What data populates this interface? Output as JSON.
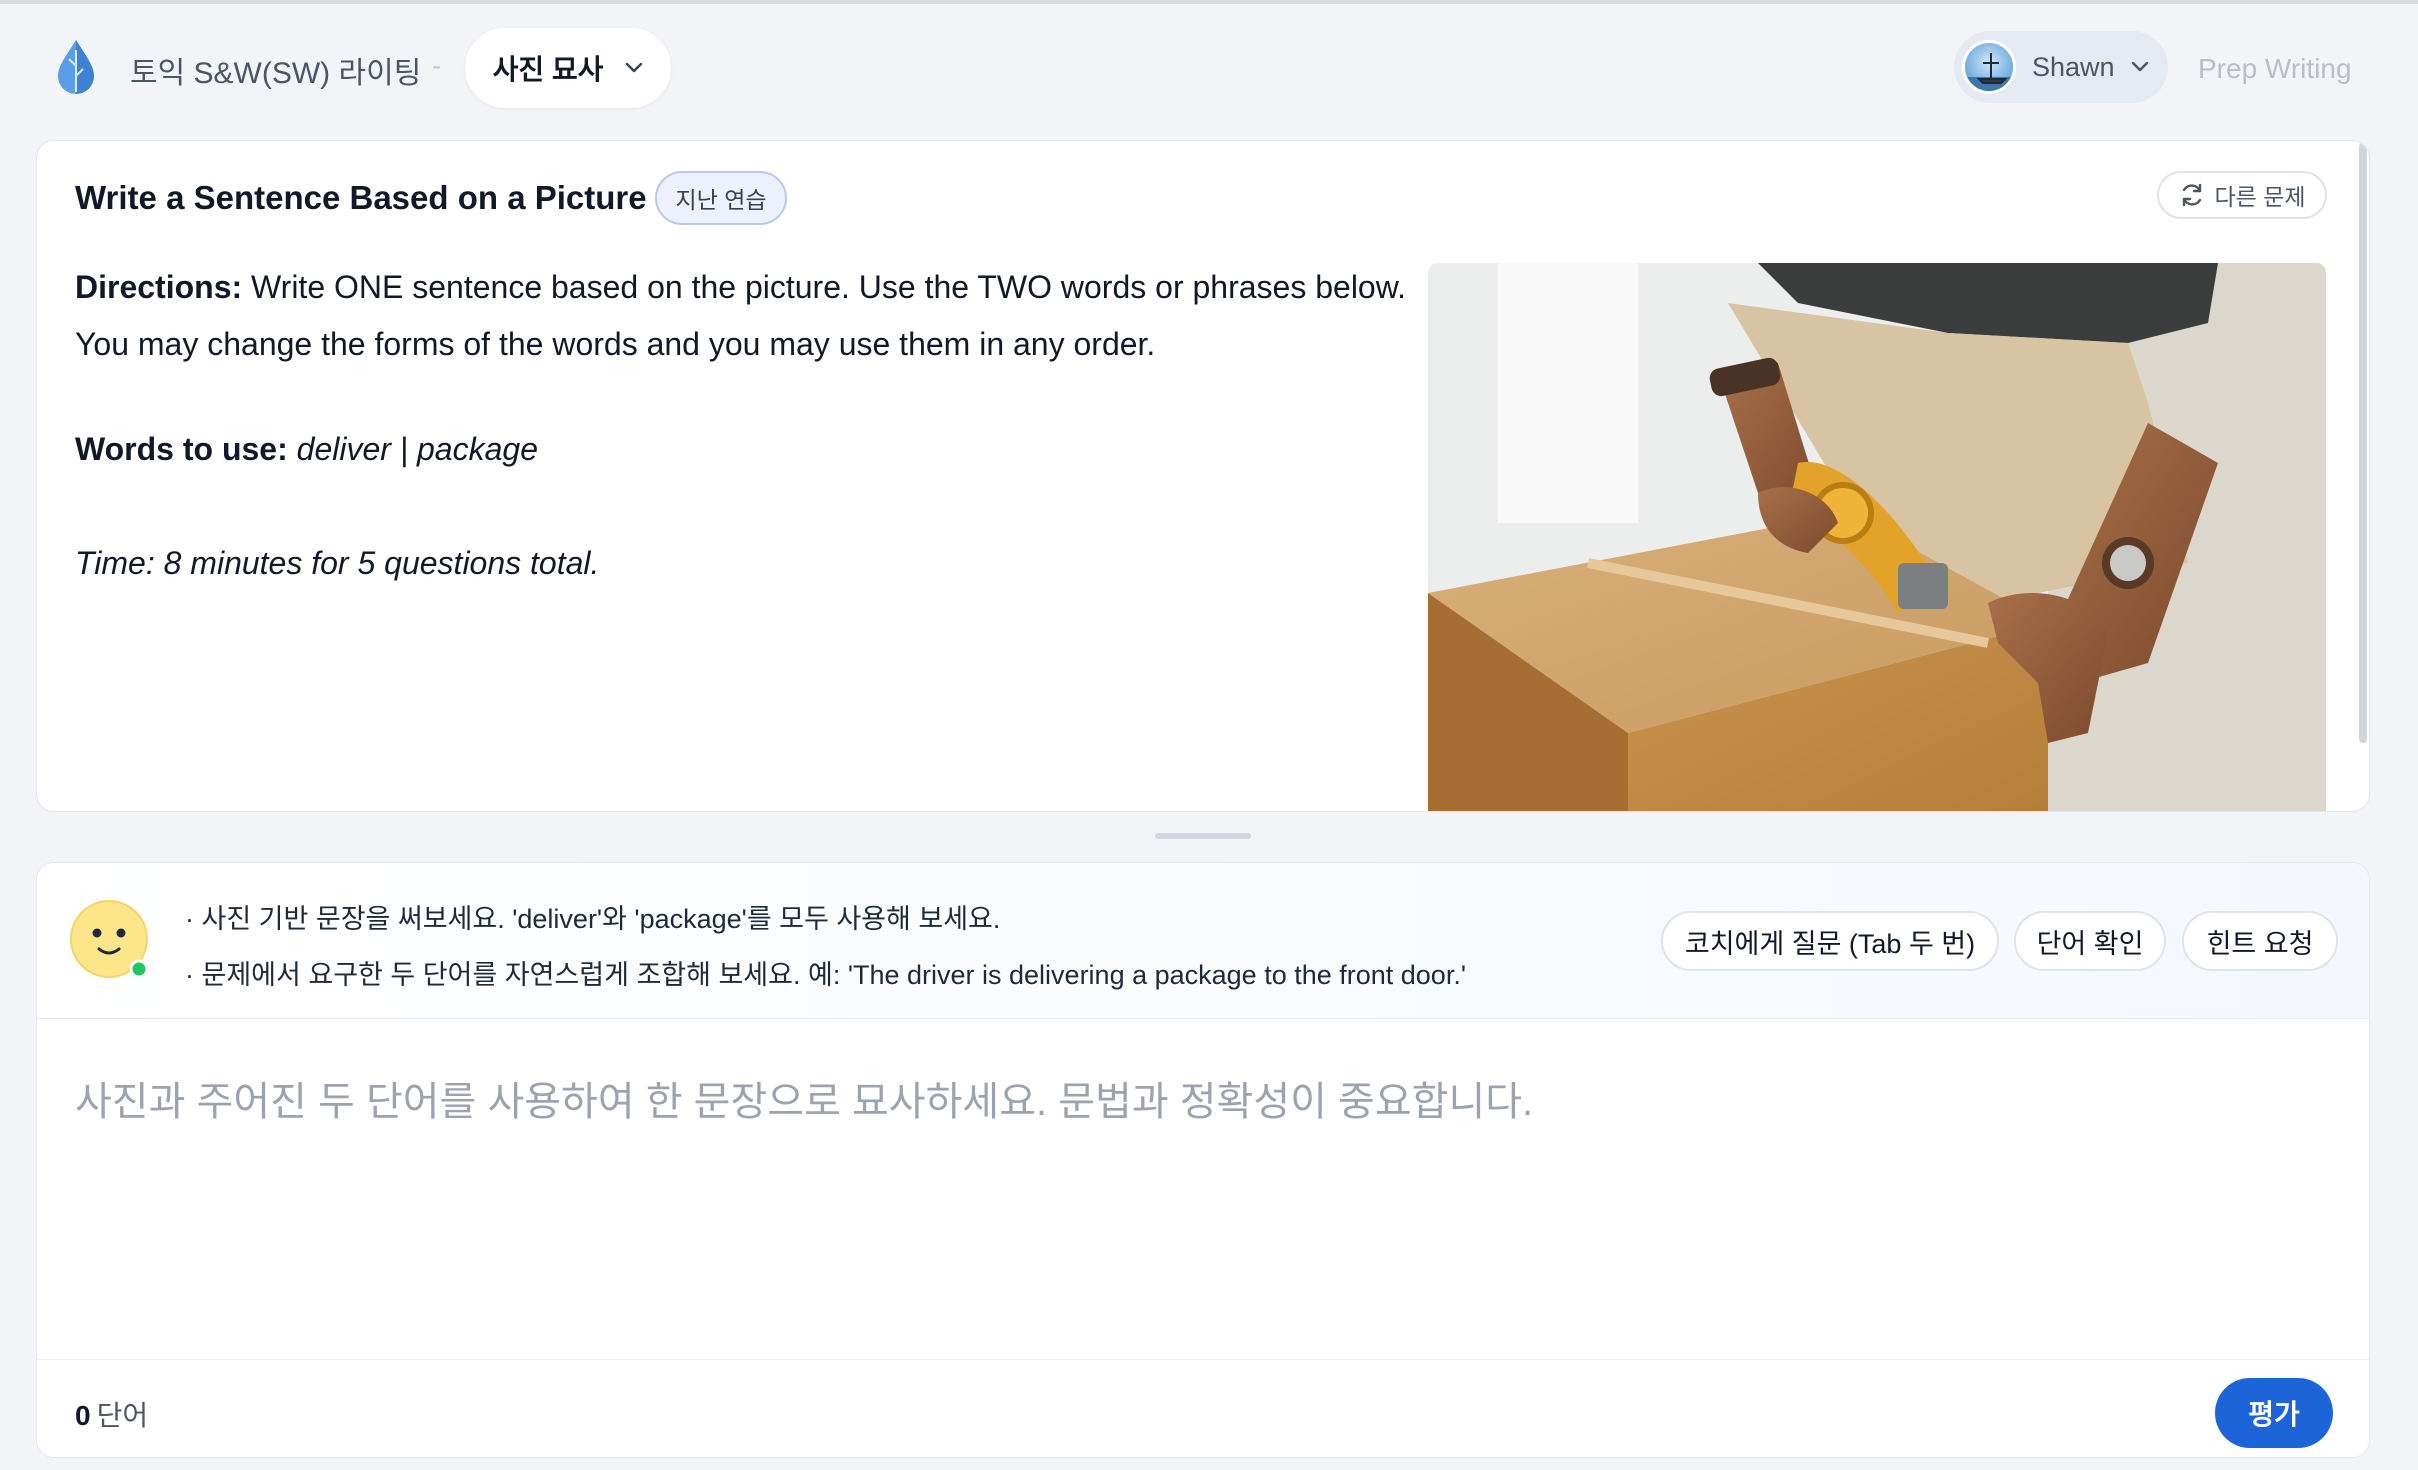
{
  "header": {
    "app_title": "토익 S&W(SW) 라이팅",
    "separator": "-",
    "mode_label": "사진 묘사",
    "user_name": "Shawn",
    "prep_link": "Prep Writing"
  },
  "question": {
    "title": "Write a Sentence Based on a Picture",
    "past_badge": "지난 연습",
    "other_button": "다른 문제",
    "directions_label": "Directions:",
    "directions_text": " Write ONE sentence based on the picture. Use the TWO words or phrases below. You may change the forms of the words and you may use them in any order.",
    "words_label": "Words to use:",
    "words_value": " deliver | package",
    "time_text": "Time: 8 minutes for 5 questions total."
  },
  "coach": {
    "hint_1": "· 사진 기반 문장을 써보세요. 'deliver'와 'package'를 모두 사용해 보세요.",
    "hint_2": "· 문제에서 요구한 두 단어를 자연스럽게 조합해 보세요. 예: 'The driver is delivering a package to the front door.'",
    "btn_ask_coach": "코치에게 질문 (Tab 두 번)",
    "btn_check_word": "단어 확인",
    "btn_hint": "힌트 요청"
  },
  "answer": {
    "placeholder": "사진과 주어진 두 단어를 사용하여 한 문장으로 묘사하세요. 문법과 정확성이 중요합니다.",
    "value": ""
  },
  "footer": {
    "word_count": "0",
    "word_unit": "단어",
    "evaluate_button": "평가"
  },
  "colors": {
    "accent": "#1d64d8",
    "badge_bg": "#edf1fd",
    "online_dot": "#22c55e",
    "background": "#f2f4f7"
  },
  "icons": {
    "logo": "water-drop-logo-icon",
    "mode_chevron": "chevron-down-icon",
    "user_chevron": "chevron-down-icon",
    "refresh": "refresh-icon",
    "coach": "smiley-coach-icon"
  }
}
